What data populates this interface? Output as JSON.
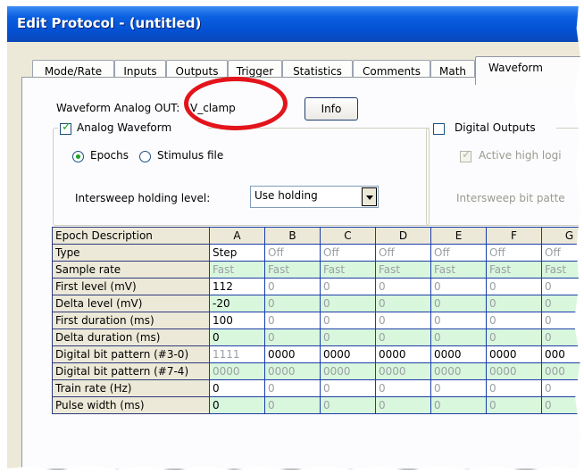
{
  "window": {
    "title": "Edit Protocol - (untitled)"
  },
  "tabs": [
    "Mode/Rate",
    "Inputs",
    "Outputs",
    "Trigger",
    "Statistics",
    "Comments",
    "Math",
    "Waveform"
  ],
  "active_tab": "Waveform",
  "waveform_channel": {
    "label": "Waveform Analog OUT:",
    "value": "V_clamp",
    "info_button": "Info"
  },
  "analog_waveform": {
    "checkbox_label": "Analog Waveform",
    "checked": true,
    "radio_epochs": "Epochs",
    "radio_stimulus": "Stimulus file",
    "selected_radio": "Epochs",
    "holding_label": "Intersweep holding level:",
    "holding_value": "Use holding"
  },
  "digital_outputs": {
    "checkbox_label": "Digital Outputs",
    "checked": false,
    "active_high_label": "Active high logi",
    "active_high_checked": true,
    "bit_pattern_label": "Intersweep bit patte"
  },
  "epoch_table": {
    "header_label": "Epoch Description",
    "columns": [
      "A",
      "B",
      "C",
      "D",
      "E",
      "F",
      "G"
    ],
    "rows": [
      {
        "label": "Type",
        "cells": [
          "Step",
          "Off",
          "Off",
          "Off",
          "Off",
          "Off",
          "Off"
        ]
      },
      {
        "label": "Sample rate",
        "cells": [
          "Fast",
          "Fast",
          "Fast",
          "Fast",
          "Fast",
          "Fast",
          "Fast"
        ]
      },
      {
        "label": "First level (mV)",
        "cells": [
          "112",
          "0",
          "0",
          "0",
          "0",
          "0",
          "0"
        ]
      },
      {
        "label": "Delta level (mV)",
        "cells": [
          "-20",
          "0",
          "0",
          "0",
          "0",
          "0",
          "0"
        ]
      },
      {
        "label": "First duration (ms)",
        "cells": [
          "100",
          "0",
          "0",
          "0",
          "0",
          "0",
          "0"
        ]
      },
      {
        "label": "Delta duration (ms)",
        "cells": [
          "0",
          "0",
          "0",
          "0",
          "0",
          "0",
          "0"
        ]
      },
      {
        "label": "Digital bit pattern (#3-0)",
        "cells": [
          "1111",
          "0000",
          "0000",
          "0000",
          "0000",
          "0000",
          "000"
        ]
      },
      {
        "label": "Digital bit pattern (#7-4)",
        "cells": [
          "0000",
          "0000",
          "0000",
          "0000",
          "0000",
          "0000",
          "000"
        ]
      },
      {
        "label": "Train rate (Hz)",
        "cells": [
          "0",
          "0",
          "0",
          "0",
          "0",
          "0",
          "0"
        ]
      },
      {
        "label": "Pulse width (ms)",
        "cells": [
          "0",
          "0",
          "0",
          "0",
          "0",
          "0",
          "0"
        ]
      }
    ]
  },
  "colors": {
    "title_bar": "#0a5fe0",
    "highlight_circle": "#e3141b",
    "cell_green": "#d9f7dd",
    "grid_line": "#1a3da8"
  }
}
